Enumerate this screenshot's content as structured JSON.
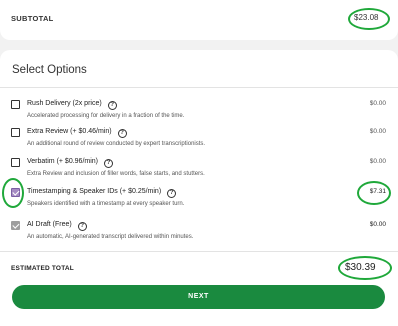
{
  "subtotal": {
    "label": "SUBTOTAL",
    "amount": "$23.08"
  },
  "section_title": "Select Options",
  "options": [
    {
      "name": "Rush Delivery (2x price)",
      "description": "Accelerated processing for delivery in a fraction of the time.",
      "price": "$0.00",
      "checked": false
    },
    {
      "name": "Extra Review (+ $0.46/min)",
      "description": "An additional round of review conducted by expert transcriptionists.",
      "price": "$0.00",
      "checked": false
    },
    {
      "name": "Verbatim (+ $0.96/min)",
      "description": "Extra Review and inclusion of filler words, false starts, and stutters.",
      "price": "$0.00",
      "checked": false
    },
    {
      "name": "Timestamping & Speaker IDs (+ $0.25/min)",
      "description": "Speakers identified with a timestamp at every speaker turn.",
      "price": "$7.31",
      "checked": true
    },
    {
      "name": "AI Draft (Free)",
      "description": "An automatic, AI-generated transcript delivered within minutes.",
      "price": "$0.00",
      "checked": true,
      "disabled": true
    }
  ],
  "estimated_total": {
    "label": "ESTIMATED TOTAL",
    "amount": "$30.39"
  },
  "next_button": {
    "label": "NEXT"
  },
  "help_icon_glyph": "?",
  "colors": {
    "primary_green": "#1a8a3f",
    "annotation_green": "#1fa83a",
    "checked_purple": "#a58bc3"
  }
}
